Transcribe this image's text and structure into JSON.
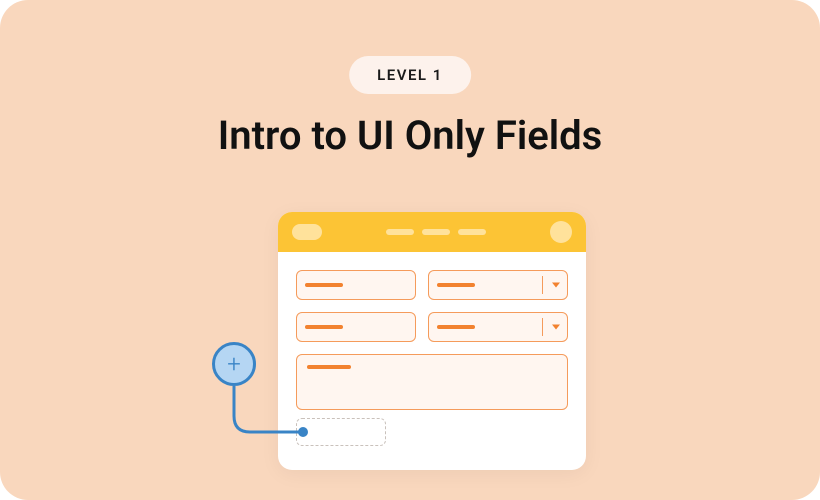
{
  "badge": {
    "label": "LEVEL 1"
  },
  "heading": "Intro to UI Only Fields",
  "window": {
    "fields": [
      {
        "type": "text"
      },
      {
        "type": "dropdown"
      },
      {
        "type": "text"
      },
      {
        "type": "dropdown"
      }
    ],
    "textarea": true,
    "placeholder_slot": true
  },
  "add_button": {
    "glyph": "+"
  },
  "colors": {
    "background": "#f9d7bd",
    "titlebar": "#fcc435",
    "titlebar_accent": "#ffe29b",
    "field_border": "#f59b5b",
    "field_fill": "#fff6f0",
    "add_fill": "#b5d6f3",
    "add_border": "#3984c6"
  }
}
